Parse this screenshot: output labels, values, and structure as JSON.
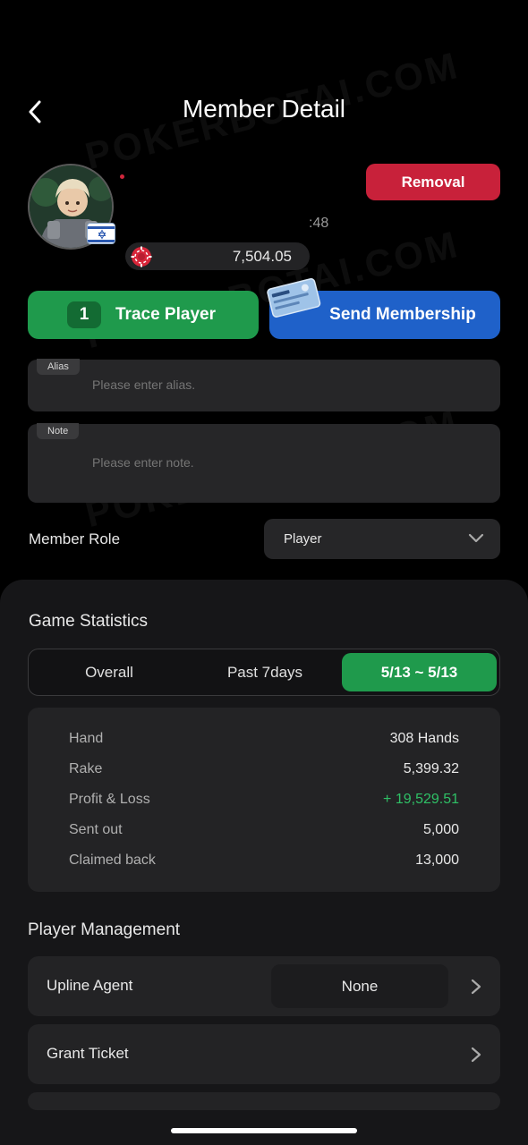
{
  "header": {
    "title": "Member Detail",
    "back_icon": "chevron-left-icon"
  },
  "profile": {
    "avatar_icon": "player-avatar",
    "flag_icon": "israel-flag-icon",
    "time_fragment": ":48",
    "balance": "7,504.05",
    "balance_icon": "poker-chip-icon",
    "online_color": "#d0263b"
  },
  "actions": {
    "removal_label": "Removal",
    "trace_count": "1",
    "trace_label": "Trace Player",
    "membership_label": "Send Membership",
    "membership_icon": "membership-card-icon"
  },
  "alias": {
    "label": "Alias",
    "placeholder": "Please enter alias.",
    "value": ""
  },
  "note": {
    "label": "Note",
    "placeholder": "Please enter note.",
    "value": ""
  },
  "role": {
    "label": "Member Role",
    "value": "Player"
  },
  "game_statistics": {
    "title": "Game Statistics",
    "tabs": [
      {
        "label": "Overall",
        "active": false
      },
      {
        "label": "Past 7days",
        "active": false
      },
      {
        "label": "5/13 ~ 5/13",
        "active": true
      }
    ],
    "rows": [
      {
        "label": "Hand",
        "value": "308 Hands"
      },
      {
        "label": "Rake",
        "value": "5,399.32"
      },
      {
        "label": "Profit & Loss",
        "value": "+ 19,529.51"
      },
      {
        "label": "Sent out",
        "value": "5,000"
      },
      {
        "label": "Claimed back",
        "value": "13,000"
      }
    ]
  },
  "player_management": {
    "title": "Player Management",
    "upline_label": "Upline Agent",
    "upline_value": "None",
    "grant_label": "Grant Ticket"
  },
  "watermark": "POKERBOTAI.COM",
  "colors": {
    "green": "#1f9a4c",
    "blue": "#1f61c9",
    "red": "#c8213a",
    "profit_green": "#2fc066"
  }
}
